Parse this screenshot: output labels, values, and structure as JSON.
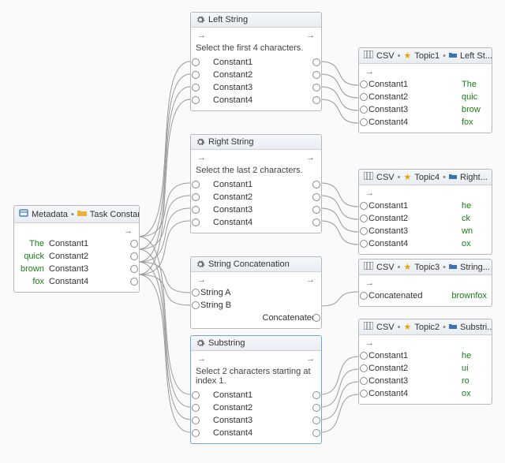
{
  "metadata": {
    "title_a": "Metadata",
    "title_b": "Task Constants",
    "rows": [
      {
        "lbl": "Constant1",
        "val": "The"
      },
      {
        "lbl": "Constant2",
        "val": "quick"
      },
      {
        "lbl": "Constant3",
        "val": "brown"
      },
      {
        "lbl": "Constant4",
        "val": "fox"
      }
    ]
  },
  "left": {
    "title": "Left String",
    "desc": "Select the first 4 characters.",
    "rows": [
      "Constant1",
      "Constant2",
      "Constant3",
      "Constant4"
    ]
  },
  "right": {
    "title": "Right String",
    "desc": "Select the last 2 characters.",
    "rows": [
      "Constant1",
      "Constant2",
      "Constant3",
      "Constant4"
    ]
  },
  "concat": {
    "title": "String Concatenation",
    "in": [
      "String A",
      "String B"
    ],
    "out": "Concatenated"
  },
  "sub": {
    "title": "Substring",
    "desc": "Select 2 characters starting at index 1.",
    "rows": [
      "Constant1",
      "Constant2",
      "Constant3",
      "Constant4"
    ]
  },
  "topic1": {
    "h": [
      "CSV",
      "Topic1",
      "Left St..."
    ],
    "rows": [
      {
        "lbl": "Constant1",
        "val": "The"
      },
      {
        "lbl": "Constant2",
        "val": "quic"
      },
      {
        "lbl": "Constant3",
        "val": "brow"
      },
      {
        "lbl": "Constant4",
        "val": "fox"
      }
    ]
  },
  "topic4": {
    "h": [
      "CSV",
      "Topic4",
      "Right..."
    ],
    "rows": [
      {
        "lbl": "Constant1",
        "val": "he"
      },
      {
        "lbl": "Constant2",
        "val": "ck"
      },
      {
        "lbl": "Constant3",
        "val": "wn"
      },
      {
        "lbl": "Constant4",
        "val": "ox"
      }
    ]
  },
  "topic3": {
    "h": [
      "CSV",
      "Topic3",
      "String..."
    ],
    "rows": [
      {
        "lbl": "Concatenated",
        "val": "brownfox"
      }
    ]
  },
  "topic2": {
    "h": [
      "CSV",
      "Topic2",
      "Substri..."
    ],
    "rows": [
      {
        "lbl": "Constant1",
        "val": "he"
      },
      {
        "lbl": "Constant2",
        "val": "ui"
      },
      {
        "lbl": "Constant3",
        "val": "ro"
      },
      {
        "lbl": "Constant4",
        "val": "ox"
      }
    ]
  }
}
